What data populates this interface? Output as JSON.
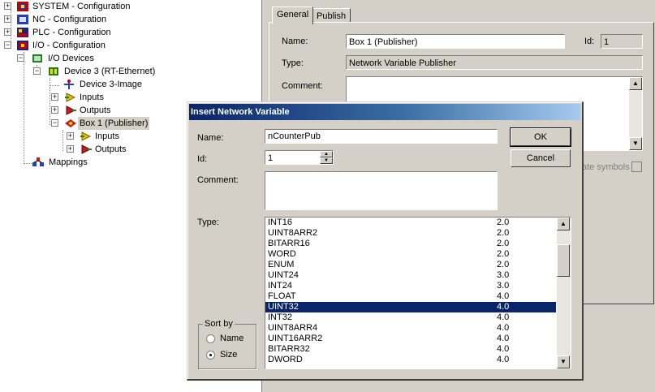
{
  "tree": {
    "items": [
      {
        "label": "SYSTEM - Configuration",
        "icon": "system-config-icon"
      },
      {
        "label": "NC - Configuration",
        "icon": "nc-config-icon"
      },
      {
        "label": "PLC - Configuration",
        "icon": "plc-config-icon"
      },
      {
        "label": "I/O - Configuration",
        "icon": "io-config-icon"
      },
      {
        "label": "I/O Devices",
        "icon": "io-devices-icon"
      },
      {
        "label": "Device 3 (RT-Ethernet)",
        "icon": "device-icon"
      },
      {
        "label": "Device 3-Image",
        "icon": "image-icon"
      },
      {
        "label": "Inputs",
        "icon": "inputs-icon"
      },
      {
        "label": "Outputs",
        "icon": "outputs-icon"
      },
      {
        "label": "Box 1 (Publisher)",
        "icon": "box-icon"
      },
      {
        "label": "Inputs",
        "icon": "inputs-icon"
      },
      {
        "label": "Outputs",
        "icon": "outputs-icon"
      },
      {
        "label": "Mappings",
        "icon": "mappings-icon"
      }
    ]
  },
  "properties": {
    "tabs": [
      "General",
      "Publish"
    ],
    "name_label": "Name:",
    "name_value": "Box 1 (Publisher)",
    "id_label": "Id:",
    "id_value": "1",
    "type_label": "Type:",
    "type_value": "Network Variable Publisher",
    "comment_label": "Comment:",
    "partial_label": "ate symbols"
  },
  "dialog": {
    "title": "Insert Network Variable",
    "name_label": "Name:",
    "name_value": "nCounterPub",
    "id_label": "Id:",
    "id_value": "1",
    "comment_label": "Comment:",
    "type_label": "Type:",
    "ok_label": "OK",
    "cancel_label": "Cancel",
    "sort_by_label": "Sort by",
    "sort_name_label": "Name",
    "sort_size_label": "Size",
    "sort_selected": "Size",
    "types": [
      {
        "name": "INT16",
        "size": "2.0"
      },
      {
        "name": "UINT8ARR2",
        "size": "2.0"
      },
      {
        "name": "BITARR16",
        "size": "2.0"
      },
      {
        "name": "WORD",
        "size": "2.0"
      },
      {
        "name": "ENUM",
        "size": "2.0"
      },
      {
        "name": "UINT24",
        "size": "3.0"
      },
      {
        "name": "INT24",
        "size": "3.0"
      },
      {
        "name": "FLOAT",
        "size": "4.0"
      },
      {
        "name": "UINT32",
        "size": "4.0",
        "selected": true
      },
      {
        "name": "INT32",
        "size": "4.0"
      },
      {
        "name": "UINT8ARR4",
        "size": "4.0"
      },
      {
        "name": "UINT16ARR2",
        "size": "4.0"
      },
      {
        "name": "BITARR32",
        "size": "4.0"
      },
      {
        "name": "DWORD",
        "size": "4.0"
      }
    ]
  },
  "colors": {
    "window_bg": "#d4d0c8",
    "title_start": "#0a246a",
    "title_end": "#a6caf0",
    "selection": "#0a246a"
  }
}
